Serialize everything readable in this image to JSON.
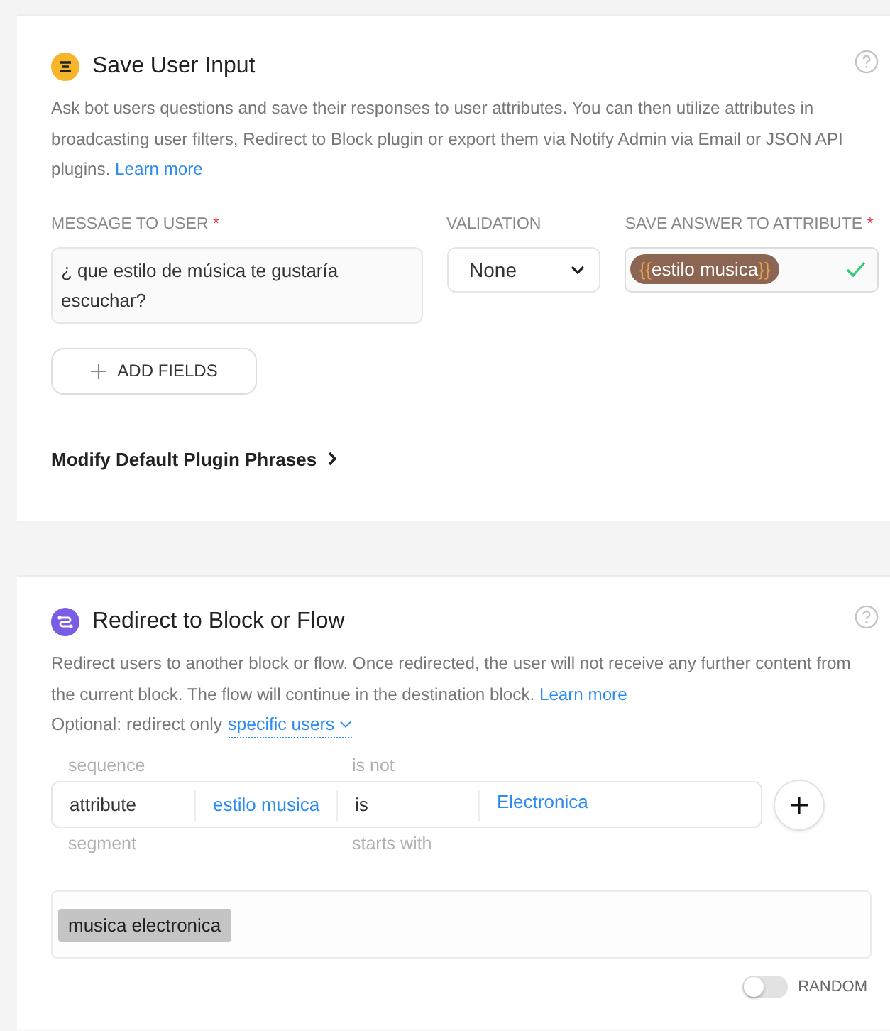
{
  "save_user_input": {
    "title": "Save User Input",
    "description": "Ask bot users questions and save their responses to user attributes. You can then utilize attributes in broadcasting user filters, Redirect to Block plugin or export them via Notify Admin via Email or JSON API plugins.",
    "learn_more": "Learn more",
    "fields": [
      {
        "kind": "text",
        "label": "MESSAGE TO USER",
        "required": true,
        "value": "¿ que estilo de música te gustaría escuchar?"
      },
      {
        "kind": "select",
        "label": "VALIDATION",
        "required": false,
        "value": "None"
      },
      {
        "kind": "attribute",
        "label": "SAVE ANSWER TO ATTRIBUTE",
        "required": true,
        "open": "{{",
        "value": "estilo musica",
        "close": "}}",
        "valid": true
      }
    ],
    "required_mark": "*",
    "add_button": "ADD FIELDS",
    "phrases_link": "Modify Default Plugin Phrases"
  },
  "redirect": {
    "title": "Redirect to Block or Flow",
    "description": "Redirect users to another block or flow. Once redirected, the user will not receive any further content from the current block. The flow will continue in the destination block.",
    "learn_more": "Learn more",
    "optional_text": "Optional: redirect only",
    "optional_link": "specific users",
    "picker_above": [
      "sequence",
      "is not"
    ],
    "condition": [
      {
        "kind": "plain",
        "text": "attribute"
      },
      {
        "kind": "link",
        "text": "estilo musica"
      },
      {
        "kind": "plain",
        "text": "is"
      },
      {
        "kind": "link",
        "text": "Electronica"
      }
    ],
    "picker_below": [
      "segment",
      "starts with"
    ],
    "blocks": [
      "musica electronica"
    ],
    "random": {
      "label": "RANDOM",
      "on": false
    }
  }
}
